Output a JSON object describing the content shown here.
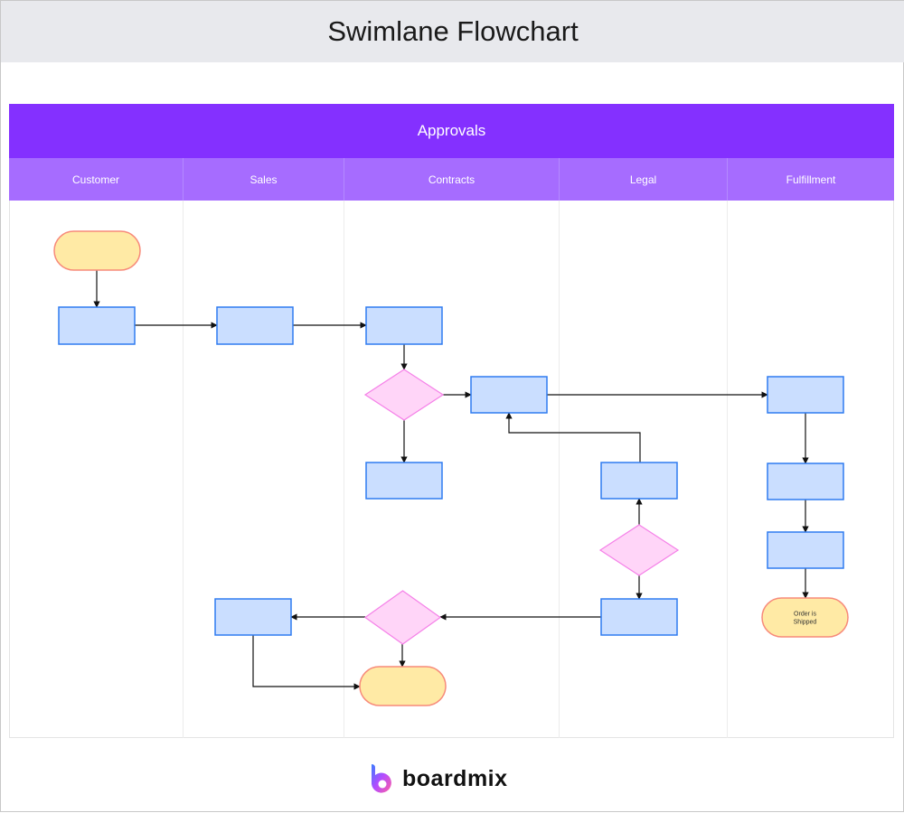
{
  "header": {
    "title": "Swimlane Flowchart"
  },
  "pool": {
    "title": "Approvals"
  },
  "lanes": [
    {
      "label": "Customer"
    },
    {
      "label": "Sales"
    },
    {
      "label": "Contracts"
    },
    {
      "label": "Legal"
    },
    {
      "label": "Fulfillment"
    }
  ],
  "colors": {
    "pool_header": "#8430ff",
    "lane_header": "#a66cff",
    "process_fill": "#cadeff",
    "process_stroke": "#2f7bf0",
    "decision_fill": "#ffd5f8",
    "decision_stroke": "#f580e8",
    "terminal_fill": "#ffeaa5",
    "terminal_stroke": "#f78a7a"
  },
  "nodes": [
    {
      "id": "start",
      "type": "terminal",
      "lane": "Customer",
      "text": ""
    },
    {
      "id": "c1",
      "type": "process",
      "lane": "Customer",
      "text": ""
    },
    {
      "id": "s1",
      "type": "process",
      "lane": "Sales",
      "text": ""
    },
    {
      "id": "k1",
      "type": "process",
      "lane": "Contracts",
      "text": ""
    },
    {
      "id": "kd1",
      "type": "decision",
      "lane": "Contracts",
      "text": ""
    },
    {
      "id": "k2",
      "type": "process",
      "lane": "Contracts",
      "text": ""
    },
    {
      "id": "k3",
      "type": "process",
      "lane": "Contracts",
      "text": ""
    },
    {
      "id": "l1",
      "type": "process",
      "lane": "Legal",
      "text": ""
    },
    {
      "id": "ld1",
      "type": "decision",
      "lane": "Legal",
      "text": ""
    },
    {
      "id": "l2",
      "type": "process",
      "lane": "Legal",
      "text": ""
    },
    {
      "id": "kd2",
      "type": "decision",
      "lane": "Contracts",
      "text": ""
    },
    {
      "id": "s2",
      "type": "process",
      "lane": "Sales",
      "text": ""
    },
    {
      "id": "end1",
      "type": "terminal",
      "lane": "Contracts",
      "text": ""
    },
    {
      "id": "f1",
      "type": "process",
      "lane": "Fulfillment",
      "text": ""
    },
    {
      "id": "f2",
      "type": "process",
      "lane": "Fulfillment",
      "text": ""
    },
    {
      "id": "f3",
      "type": "process",
      "lane": "Fulfillment",
      "text": ""
    },
    {
      "id": "end2",
      "type": "terminal",
      "lane": "Fulfillment",
      "text": "Order is Shipped"
    }
  ],
  "edges": [
    {
      "from": "start",
      "to": "c1"
    },
    {
      "from": "c1",
      "to": "s1"
    },
    {
      "from": "s1",
      "to": "k1"
    },
    {
      "from": "k1",
      "to": "kd1"
    },
    {
      "from": "kd1",
      "to": "k2"
    },
    {
      "from": "kd1",
      "to": "k3"
    },
    {
      "from": "k2",
      "to": "f1"
    },
    {
      "from": "l1",
      "to": "k2"
    },
    {
      "from": "ld1",
      "to": "l1"
    },
    {
      "from": "ld1",
      "to": "l2"
    },
    {
      "from": "l2",
      "to": "kd2"
    },
    {
      "from": "kd2",
      "to": "s2"
    },
    {
      "from": "kd2",
      "to": "end1"
    },
    {
      "from": "s2",
      "to": "end1"
    },
    {
      "from": "f1",
      "to": "f2"
    },
    {
      "from": "f2",
      "to": "f3"
    },
    {
      "from": "f3",
      "to": "end2"
    }
  ],
  "footer": {
    "brand": "boardmix"
  }
}
